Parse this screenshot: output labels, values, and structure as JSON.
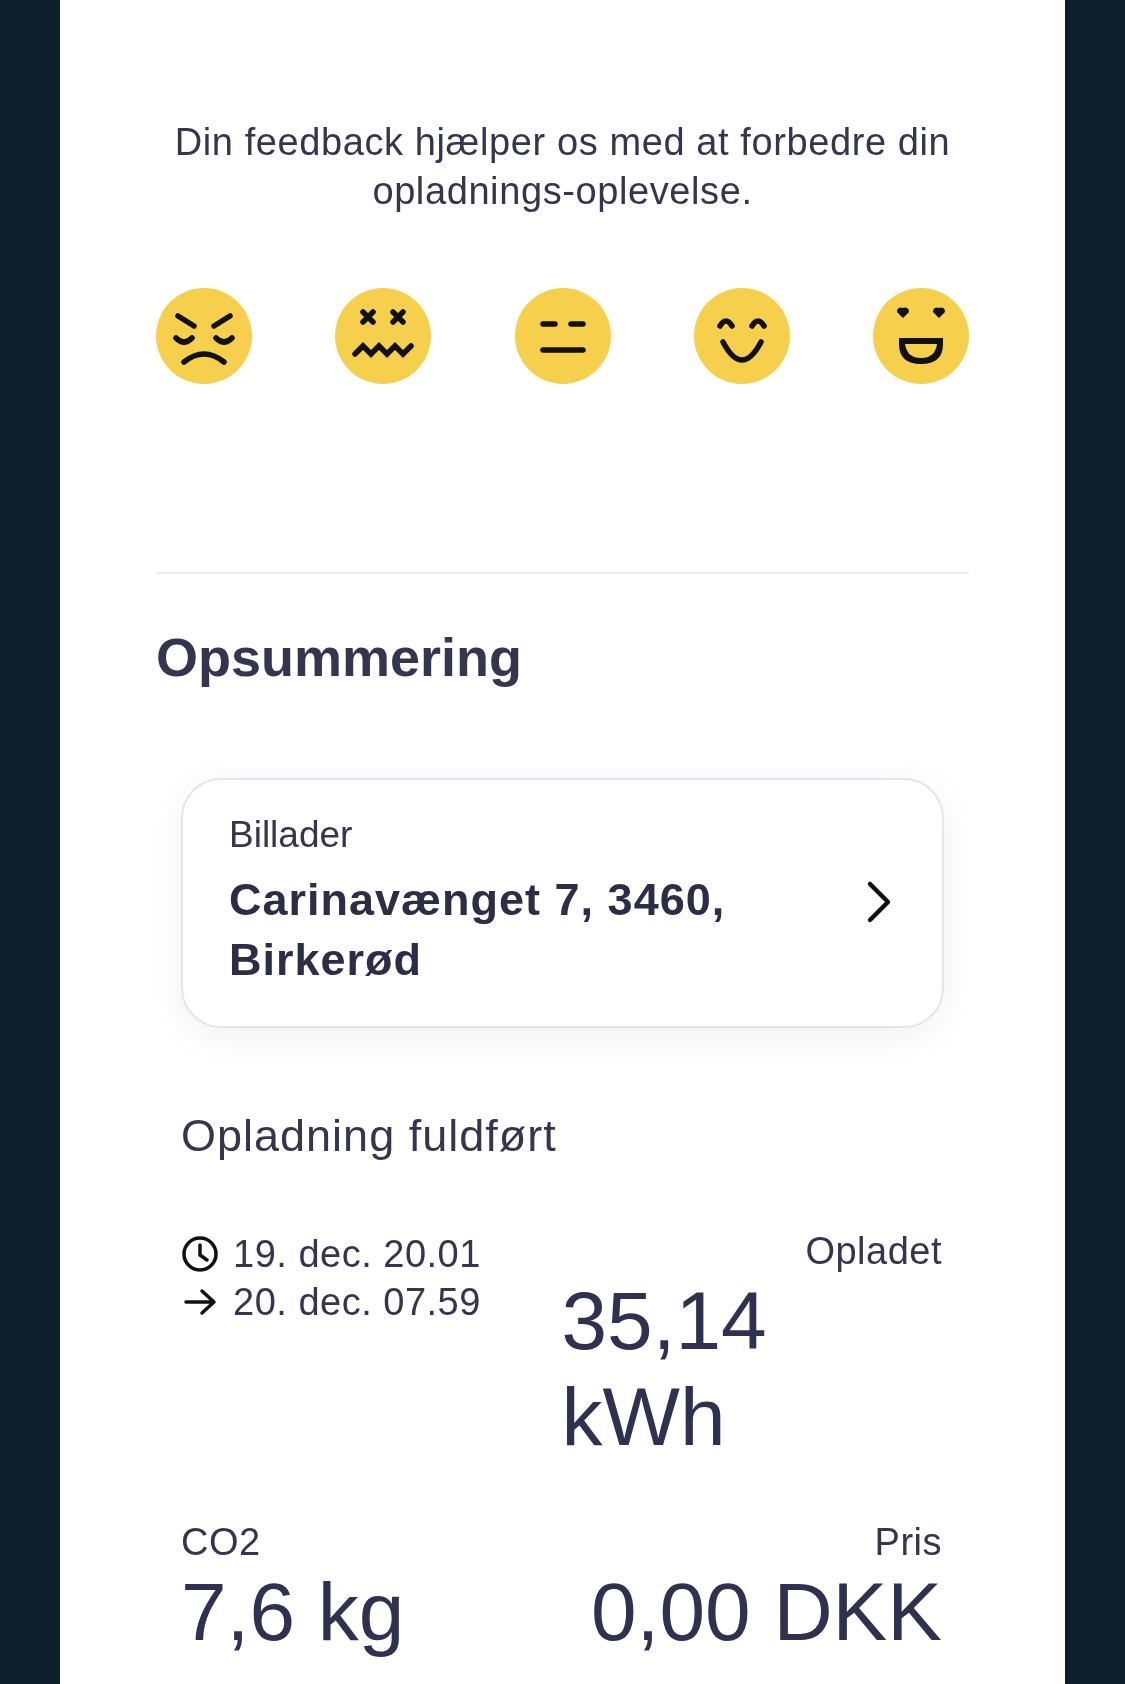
{
  "feedback": {
    "text": "Din feedback hjælper os med at forbedre din opladnings-oplevelse.",
    "ratings": [
      {
        "kind": "angry"
      },
      {
        "kind": "dizzy"
      },
      {
        "kind": "neutral"
      },
      {
        "kind": "smile"
      },
      {
        "kind": "grin"
      }
    ]
  },
  "summary": {
    "title": "Opsummering",
    "charger": {
      "label": "Billader",
      "address": "Carinavænget 7, 3460, Birkerød"
    },
    "status": "Opladning fuldført",
    "start": "19. dec. 20.01",
    "end": "20. dec. 07.59",
    "charged_label": "Opladet",
    "charged_value": "35,14 kWh",
    "co2_label": "CO2",
    "co2_value": "7,6 kg",
    "price_label": "Pris",
    "price_value": "0,00 DKK"
  }
}
